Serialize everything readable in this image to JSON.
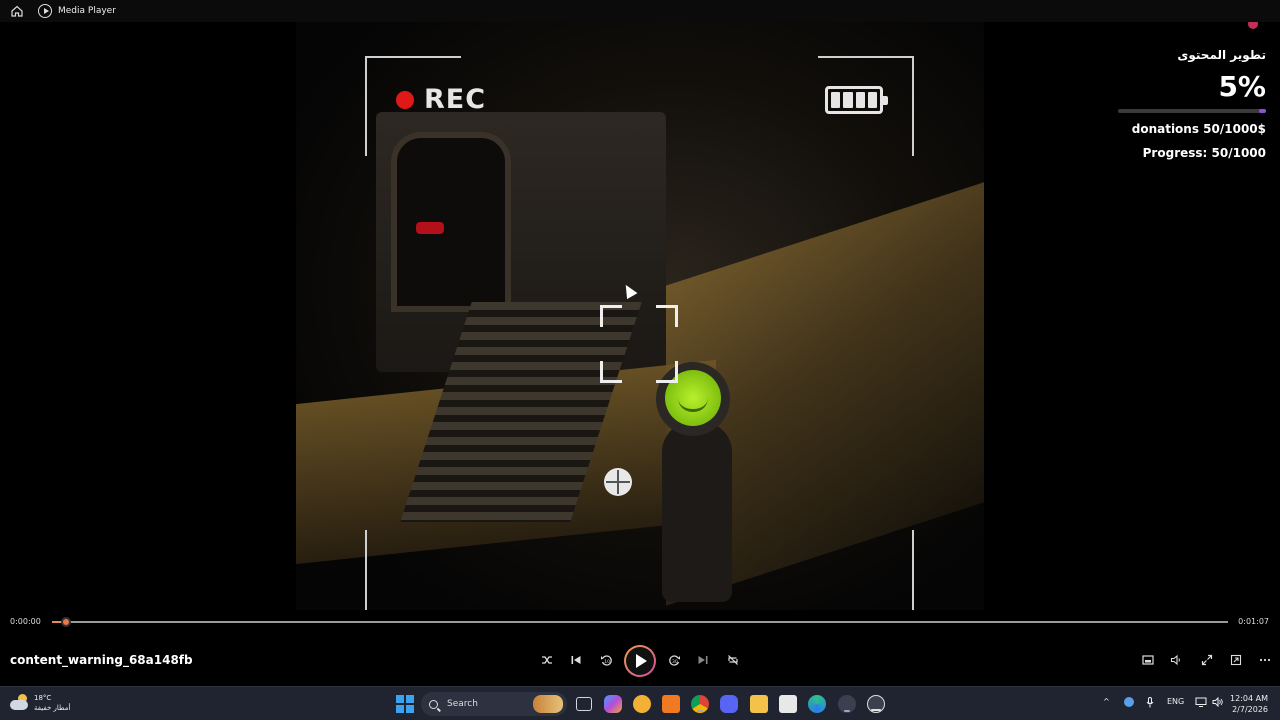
{
  "titlebar": {
    "title": "Media Player"
  },
  "overlay": {
    "rec_label": "REC",
    "battery_cells": 4
  },
  "widget": {
    "title": "تطوير المحتوى",
    "percent": "5%",
    "progress_fraction": 0.05,
    "donations": "donations 50/1000$",
    "progress": "Progress: 50/1000"
  },
  "player": {
    "time_current": "0:00:00",
    "time_total": "0:01:07",
    "position_fraction": 0.012,
    "filename": "content_warning_68a148fb",
    "controls": [
      "shuffle-icon",
      "previous-icon",
      "rewind-10-icon",
      "play-icon",
      "forward-30-icon",
      "next-icon",
      "repeat-off-icon"
    ],
    "right_controls": [
      "miniplayer-icon",
      "volume-icon",
      "fullscreen-icon",
      "cast-icon",
      "more-icon"
    ]
  },
  "taskbar": {
    "weather_temp": "18°C",
    "weather_desc": "أمطار خفيفة",
    "search_label": "Search",
    "language": "ENG",
    "time": "12:04 AM",
    "date": "2/7/2026",
    "apps": [
      "task-view",
      "copilot",
      "chrome-notify",
      "orange-app",
      "chrome",
      "discord",
      "file-explorer",
      "store",
      "edge",
      "app-badge",
      "media-player"
    ],
    "colors": {
      "start": "#3aa3f0",
      "taskbar_bg": "#1f2430",
      "accent_gradient_start": "#f0a04a",
      "accent_gradient_end": "#d04aa0",
      "widget_bar": "#8e4fd9"
    }
  }
}
